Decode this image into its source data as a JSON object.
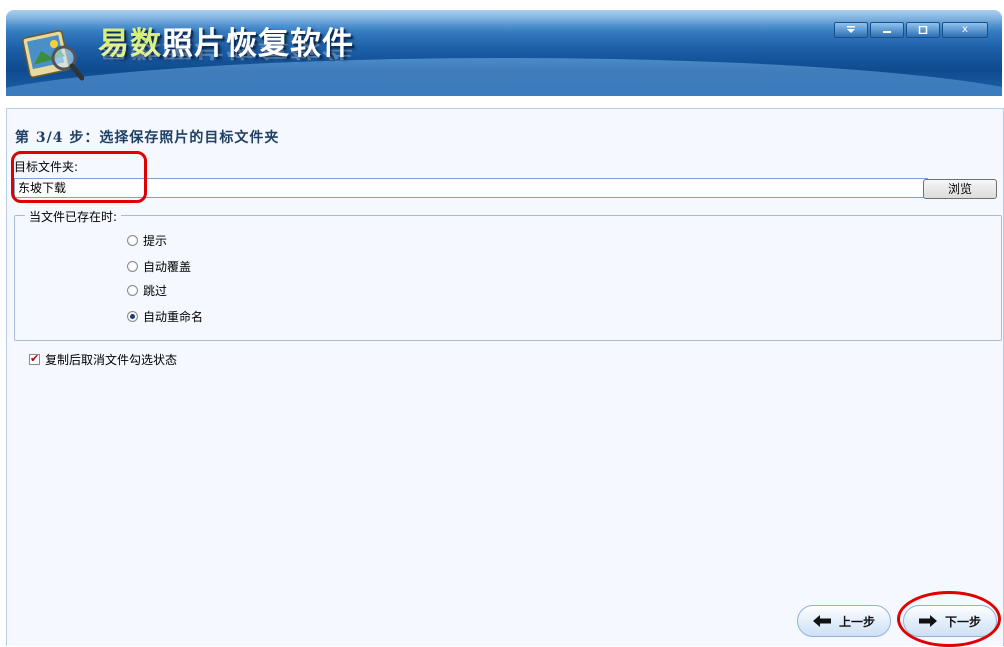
{
  "app": {
    "title": "易数照片恢复软件",
    "title_part1": "易数",
    "title_part2": "照片恢复软件"
  },
  "window_controls": {
    "menu_icon": "dropdown-arrow-icon",
    "minimize_icon": "minimize-icon",
    "maximize_icon": "maximize-icon",
    "close_label": "x"
  },
  "step": {
    "title": "第 3/4 步：选择保存照片的目标文件夹"
  },
  "folder": {
    "label": "目标文件夹:",
    "value": "东坡下载",
    "browse_label": "浏览"
  },
  "exists_group": {
    "legend": "当文件已存在时:",
    "options": [
      {
        "label": "提示",
        "checked": false
      },
      {
        "label": "自动覆盖",
        "checked": false
      },
      {
        "label": "跳过",
        "checked": false
      },
      {
        "label": "自动重命名",
        "checked": true
      }
    ]
  },
  "uncheck_after_copy": {
    "label": "复制后取消文件勾选状态",
    "checked": true
  },
  "nav": {
    "prev_label": "上一步",
    "next_label": "下一步"
  },
  "colors": {
    "header": "#1c5fa8",
    "highlight": "#e00000",
    "content_bg": "#f5f9ff"
  }
}
